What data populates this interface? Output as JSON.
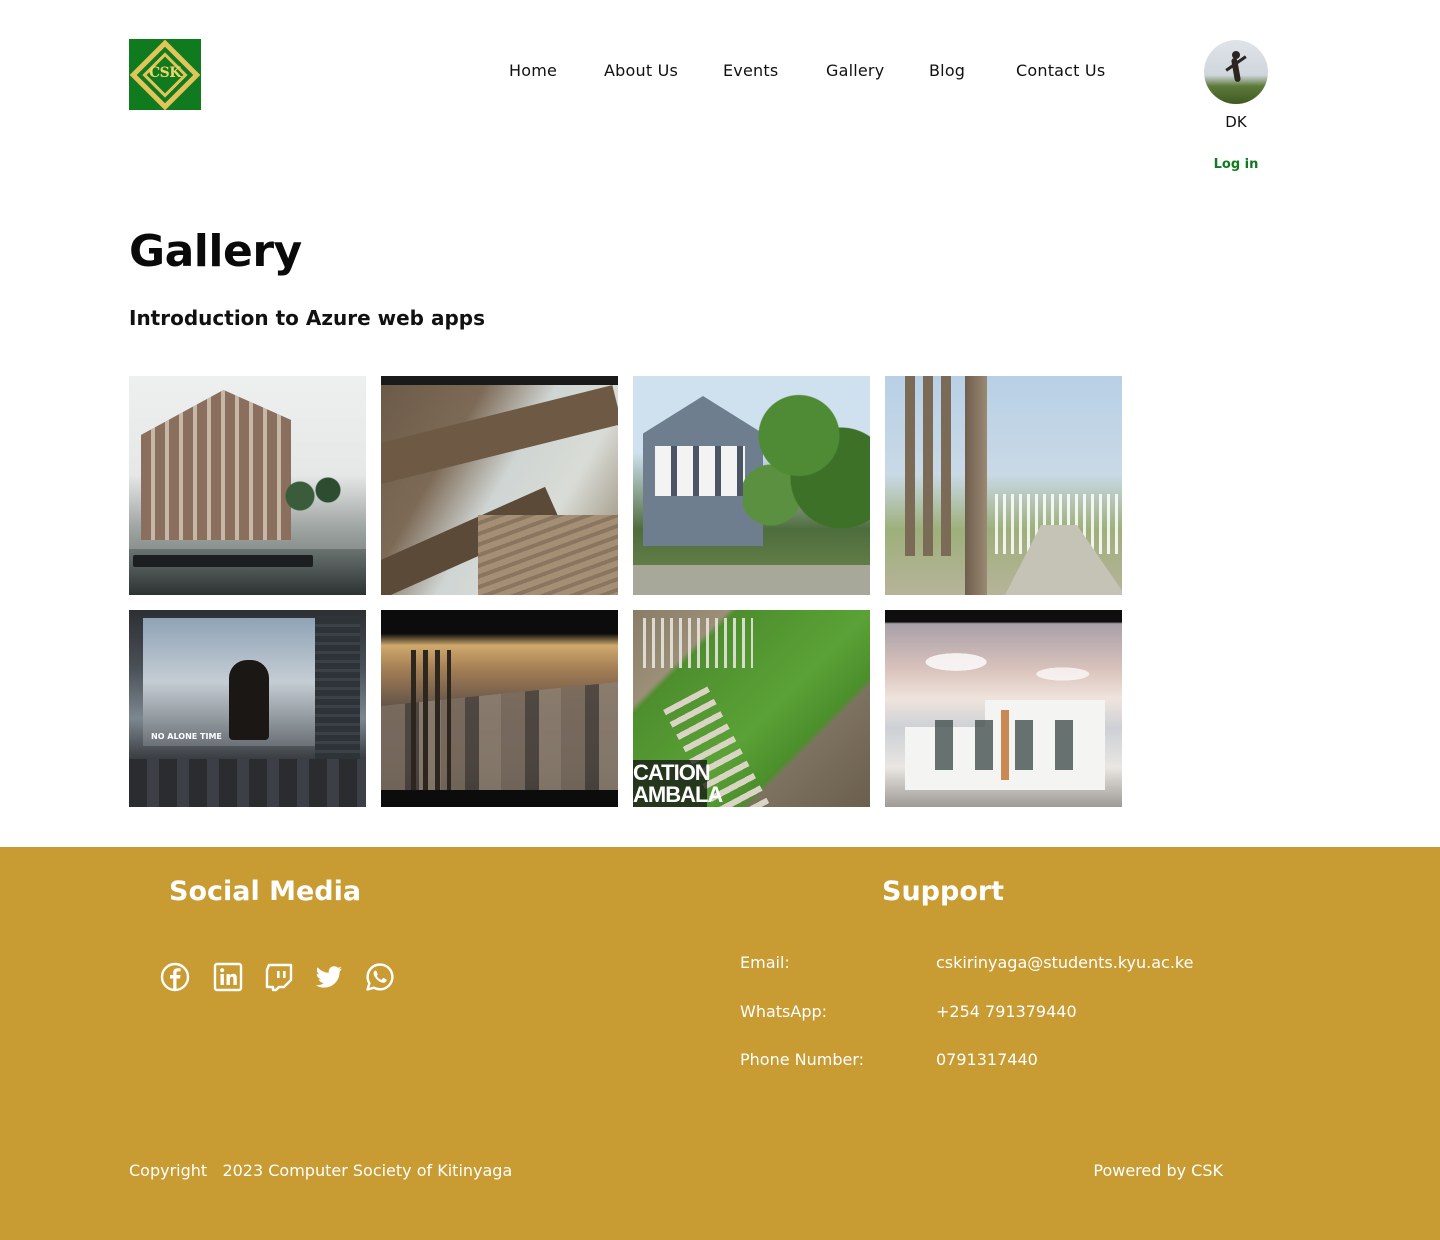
{
  "header": {
    "logo_text": "CSK",
    "nav": [
      "Home",
      "About Us",
      "Events",
      "Gallery",
      "Blog",
      "Contact Us"
    ],
    "user": {
      "name": "DK",
      "login_label": "Log in"
    }
  },
  "main": {
    "title": "Gallery",
    "album_title": "Introduction to Azure web apps",
    "photos": [
      {
        "caption": ""
      },
      {
        "caption": ""
      },
      {
        "caption": ""
      },
      {
        "caption": ""
      },
      {
        "caption": "NO ALONE TIME"
      },
      {
        "caption": ""
      },
      {
        "caption": "CATION\nAMBALA"
      },
      {
        "caption": ""
      }
    ]
  },
  "footer": {
    "social_heading": "Social Media",
    "social_icons": [
      "facebook-icon",
      "linkedin-icon",
      "twitch-icon",
      "twitter-icon",
      "whatsapp-icon"
    ],
    "support_heading": "Support",
    "support": [
      {
        "label": "Email:",
        "value": "cskirinyaga@students.kyu.ac.ke"
      },
      {
        "label": "WhatsApp:",
        "value": "+254 791379440"
      },
      {
        "label": "Phone Number:",
        "value": "0791317440"
      }
    ],
    "copyright": "Copyright   2023 Computer Society of Kitinyaga",
    "powered_by": "Powered by CSK"
  },
  "colors": {
    "brand_green": "#0f7a1e",
    "logo_gold": "#e2c45a",
    "footer_gold": "#c89b33",
    "text_dark": "#111111"
  }
}
